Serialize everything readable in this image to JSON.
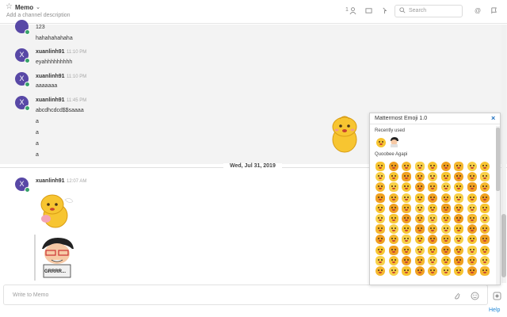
{
  "header": {
    "channel_name": "Memo",
    "description_placeholder": "Add a channel description",
    "member_count": "1",
    "search_placeholder": "Search",
    "icons": [
      "star-icon",
      "chevron-down-icon",
      "member-icon",
      "pinned-icon",
      "flag-icon",
      "search-icon",
      "at-mention-icon",
      "saved-icon"
    ]
  },
  "posts": {
    "top_lines": [
      "123",
      "hahahahahaha"
    ],
    "p1": {
      "avatar_letter": "X",
      "user": "xuanlinh91",
      "time": "11:10 PM",
      "text": "eyahhhhhhhhh"
    },
    "p2": {
      "avatar_letter": "X",
      "user": "xuanlinh91",
      "time": "11:10 PM",
      "text": "aaaaaaa"
    },
    "p3": {
      "avatar_letter": "X",
      "user": "xuanlinh91",
      "time": "11:45 PM",
      "lines": [
        "abcdhcdcd$$saaaa",
        "a",
        "a",
        "a",
        "a"
      ]
    },
    "date_separator": "Wed, Jul 31, 2019",
    "p4": {
      "avatar_letter": "X",
      "user": "xuanlinh91",
      "time": "12:07 AM",
      "sticker_text": "GRRRR..."
    }
  },
  "composer": {
    "placeholder": "Write to Memo",
    "help": "Help"
  },
  "emoji_panel": {
    "title": "Mattermost Emoji 1.0",
    "close": "×",
    "recent_label": "Recently used",
    "pack_label": "Quoobee Agapi",
    "colors": {
      "yellow": "#f7c531",
      "orange": "#f0a020",
      "dark": "#4a3418"
    }
  }
}
